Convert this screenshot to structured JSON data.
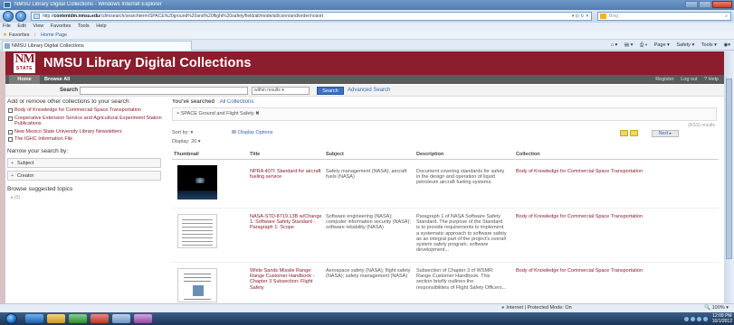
{
  "browser": {
    "title": "NMSU Library Digital Collections - Windows Internet Explorer",
    "url_prefix": "http://",
    "url_host": "contentdm.nmsu.edu",
    "url_rest": "/cdm/search/searchterm/SPACE%20ground%20and%20flight%20safety/field/all/mode/all/conn/and/order/nosort",
    "search_provider": "Bing",
    "menu": [
      "File",
      "Edit",
      "View",
      "Favorites",
      "Tools",
      "Help"
    ],
    "favorites_label": "Favorites",
    "favorites_page": "Home Page",
    "tab_title": "NMSU Library Digital Collections",
    "commands": [
      "Page ▾",
      "Safety ▾",
      "Tools ▾"
    ],
    "status_zone": "Internet | Protected Mode: On",
    "zoom": "100%",
    "clock_time": "12:09 PM",
    "clock_date": "10/1/2012"
  },
  "site": {
    "logo_main": "NM",
    "logo_sub": "STATE",
    "title": "NMSU Library Digital Collections",
    "nav_home": "Home",
    "nav_browse": "Browse All",
    "nav_right": [
      "Register",
      "Log out",
      "? Help"
    ],
    "search_label": "Search",
    "search_value": "",
    "search_scope": "within results ▾",
    "search_button": "Search",
    "advanced_search": "Advanced Search"
  },
  "left": {
    "add_heading": "Add or remove other collections to your search:",
    "collections": [
      "Body of Knowledge for Commercial Space Transportation",
      "Cooperative Extension Service and Agricultural Experiment Station Publications",
      "New Mexico State University Library Newsletters",
      "The IGHC Information File"
    ],
    "narrow_heading": "Narrow your search by:",
    "facets": [
      "Subject",
      "Creator"
    ],
    "browse_heading": "Browse suggested topics",
    "browse_more": "▸ (0)"
  },
  "main": {
    "searched_label": "You've searched",
    "searched_coll": "All Collections",
    "crumb_term": "× SPACE Ground and Flight Safety ✖",
    "rss": "(RSS) results",
    "sort_by": "Sort by:  ▾",
    "display_options": "Display Options",
    "pager": "Next ▸",
    "display_count": "Display: 20 ▾",
    "columns": [
      "Thumbnail",
      "Title",
      "Subject",
      "Description",
      "Collection"
    ],
    "rows": [
      {
        "thumb": "space",
        "title": "NPRA 407l: Standard for aircraft fueling service",
        "subject": "Safety management (NASA); aircraft fuels (NASA)",
        "description": "Document covering standards for safety in the design and operation of liquid petroleum aircraft fueling systems.",
        "collection": "Body of Knowledge for Commercial Space Transportation"
      },
      {
        "thumb": "doc",
        "title": "NASA-STD-8719.13B w/Change 1: Software Safety Standard - Paragraph 1: Scope",
        "subject": "Software engineering (NASA); computer information security (NASA); software reliability (NASA)",
        "description": "Paragraph 1 of NASA Software Safety Standard. The purpose of the Standard is to provide requirements to implement a systematic approach to software safety as an integral part of the project's overall system safety program, software development...",
        "collection": "Body of Knowledge for Commercial Space Transportation"
      },
      {
        "thumb": "doc2",
        "title": "White Sands Missile Range: Range Customer Handbook - Chapter 3 Subsection: Flight Safety",
        "subject": "Aerospace safety (NASA); flight safety (NASA); safety management (NASA)",
        "description": "Subsection of Chapter 3 of WSMR: Range Customer Handbook. This section briefly outlines the responsibilities of Flight Safety Officers...",
        "collection": "Body of Knowledge for Commercial Space Transportation"
      }
    ]
  }
}
